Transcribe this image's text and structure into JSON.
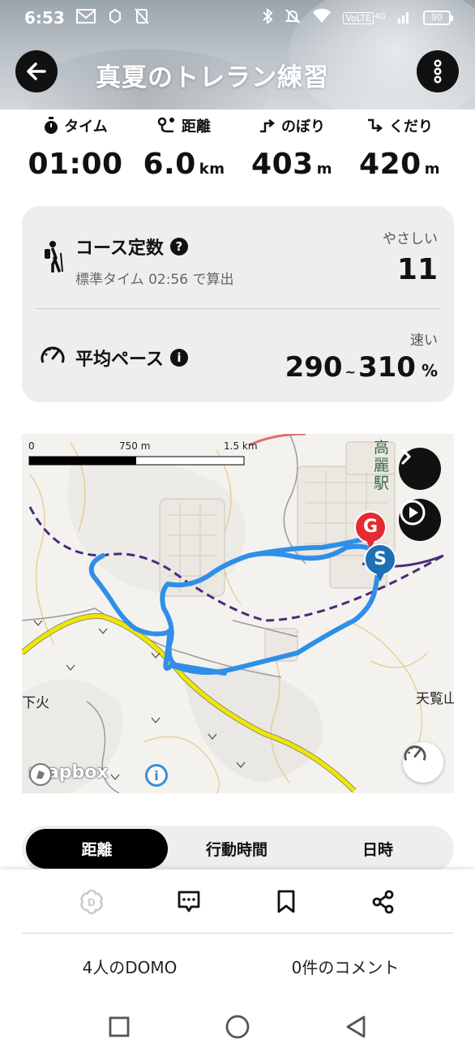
{
  "status_bar": {
    "time": "6:53",
    "network": "VoLTE",
    "network_gen": "4G",
    "battery": "90",
    "icons": [
      "gmail-icon",
      "notification-icon",
      "no-sim-icon",
      "bluetooth-icon",
      "mute-icon",
      "wifi-icon",
      "signal-icon",
      "battery-icon"
    ]
  },
  "header": {
    "title": "真夏のトレラン練習",
    "back_icon": "arrow-left-icon",
    "menu_icon": "more-vertical-icon"
  },
  "stats": [
    {
      "label": "タイム",
      "value": "01:00",
      "unit": "",
      "icon": "stopwatch-icon"
    },
    {
      "label": "距離",
      "value": "6.0",
      "unit": "km",
      "icon": "route-icon"
    },
    {
      "label": "のぼり",
      "value": "403",
      "unit": "m",
      "icon": "ascent-icon"
    },
    {
      "label": "くだり",
      "value": "420",
      "unit": "m",
      "icon": "descent-icon"
    }
  ],
  "course": {
    "title": "コース定数",
    "help": "?",
    "subtitle": "標準タイム 02:56 で算出",
    "difficulty": "やさしい",
    "value": "11",
    "icon": "hiker-icon"
  },
  "pace": {
    "title": "平均ペース",
    "info": "i",
    "speed_label": "速い",
    "low": "290",
    "sep": "~",
    "high": "310",
    "unit": "%",
    "icon": "speedometer-icon"
  },
  "map": {
    "scale_labels": [
      "0",
      "750 m",
      "1.5 km"
    ],
    "place_labels": [
      "高麗駅",
      "下火",
      "天覧山"
    ],
    "start_marker": "S",
    "goal_marker": "G",
    "attribution": "mapbox",
    "attribution_info": "i",
    "colors": {
      "route": "#2f8fe8",
      "road": "#f2e600",
      "start": "#1f6fb5",
      "goal": "#e52b30",
      "rail": "#4a2c7a"
    }
  },
  "graph_tabs": [
    {
      "label": "距離",
      "selected": true
    },
    {
      "label": "行動時間",
      "selected": false
    },
    {
      "label": "日時",
      "selected": false
    }
  ],
  "actions": {
    "icons": [
      "domo-icon",
      "comment-icon",
      "bookmark-icon",
      "share-icon"
    ],
    "domo_count": "4人のDOMO",
    "comment_count": "0件のコメント"
  },
  "nav": {
    "icons": [
      "recents-square-icon",
      "home-circle-icon",
      "back-triangle-icon"
    ]
  }
}
